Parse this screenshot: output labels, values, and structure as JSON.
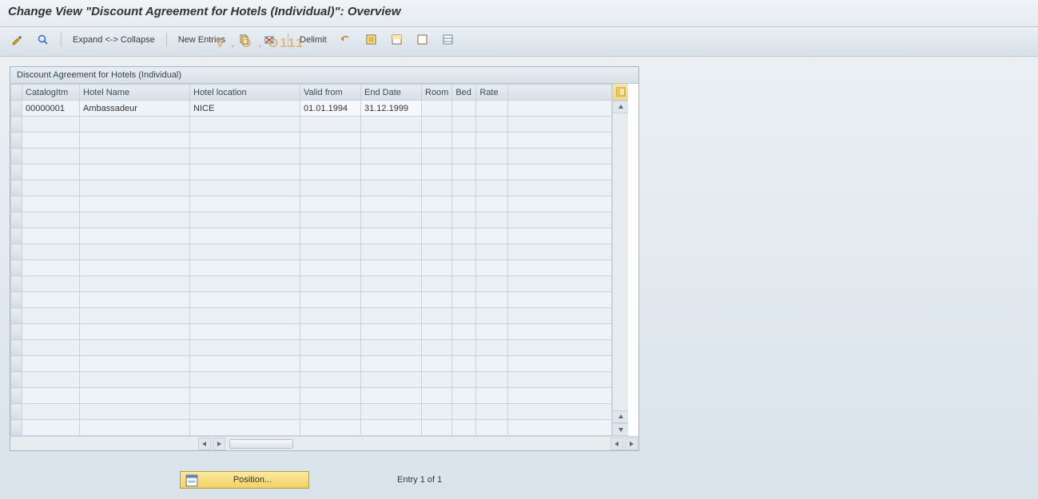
{
  "title": "Change View \"Discount Agreement for Hotels (Individual)\": Overview",
  "toolbar": {
    "expand_collapse": "Expand <-> Collapse",
    "new_entries": "New Entries",
    "delimit": "Delimit"
  },
  "panel": {
    "title": "Discount Agreement for Hotels (Individual)",
    "columns": {
      "catalog": "CatalogItm",
      "hotel_name": "Hotel Name",
      "hotel_location": "Hotel location",
      "valid_from": "Valid from",
      "end_date": "End Date",
      "room": "Room",
      "bed": "Bed",
      "rate": "Rate"
    },
    "rows": [
      {
        "catalog": "00000001",
        "hotel_name": "Ambassadeur",
        "hotel_location": "NICE",
        "valid_from": "01.01.1994",
        "end_date": "31.12.1999",
        "room": "",
        "bed": "",
        "rate": ""
      }
    ]
  },
  "footer": {
    "position_button": "Position...",
    "entry_text": "Entry 1 of 1"
  },
  "watermark": "V        .       O     .           O111"
}
